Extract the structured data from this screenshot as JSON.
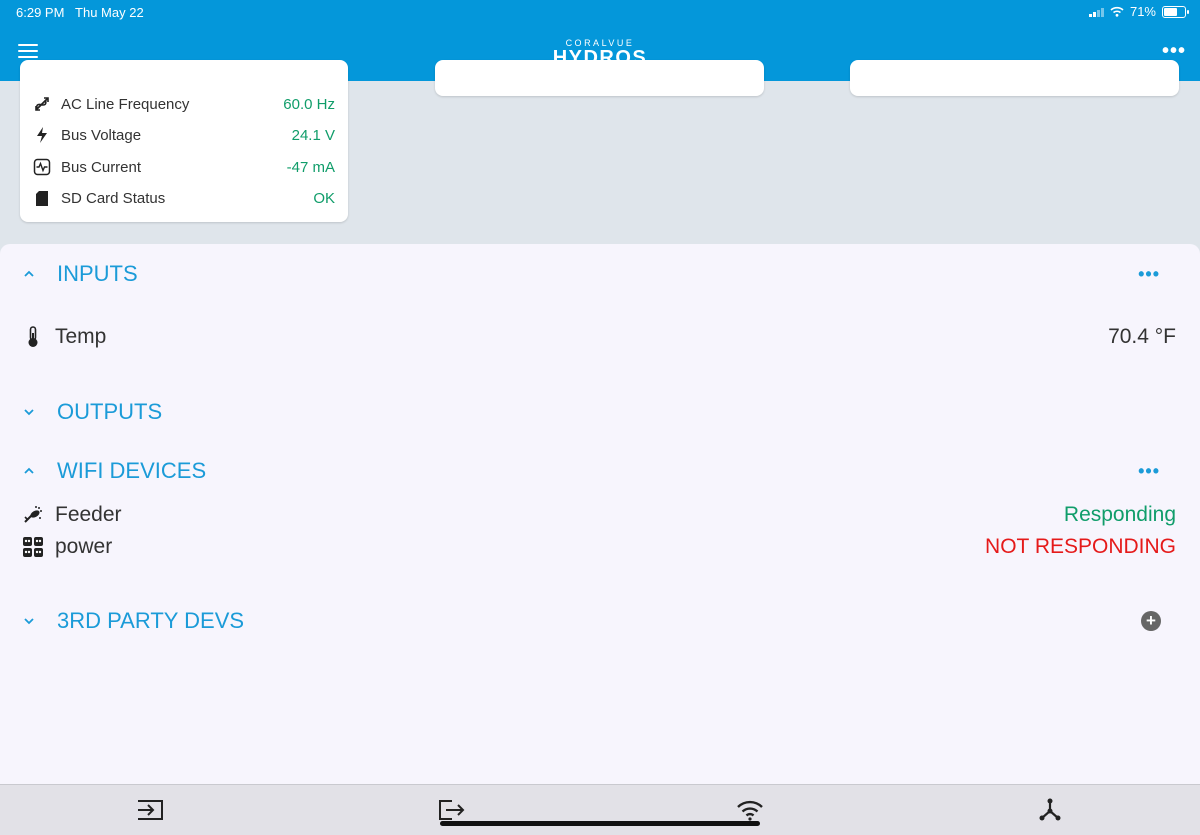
{
  "status_bar": {
    "time": "6:29 PM",
    "date": "Thu May 22",
    "battery": "71%"
  },
  "header": {
    "logo_top": "CORALVUE",
    "logo_main": "HYDROS",
    "more": "•••"
  },
  "system_card": {
    "rows": [
      {
        "icon": "frequency-icon",
        "label": "AC Line Frequency",
        "value": "60.0 Hz"
      },
      {
        "icon": "bolt-icon",
        "label": "Bus Voltage",
        "value": "24.1 V"
      },
      {
        "icon": "pulse-icon",
        "label": "Bus Current",
        "value": "-47 mA"
      },
      {
        "icon": "sd-card-icon",
        "label": "SD Card Status",
        "value": "OK"
      }
    ]
  },
  "sections": {
    "inputs": {
      "title": "INPUTS",
      "action": "•••",
      "items": [
        {
          "icon": "thermometer-icon",
          "label": "Temp",
          "value": "70.4 °F"
        }
      ]
    },
    "outputs": {
      "title": "OUTPUTS"
    },
    "wifi": {
      "title": "WIFI DEVICES",
      "action": "•••",
      "items": [
        {
          "icon": "feeder-icon",
          "label": "Feeder",
          "value": "Responding"
        },
        {
          "icon": "power-strip-icon",
          "label": "power",
          "value": "NOT RESPONDING"
        }
      ]
    },
    "third_party": {
      "title": "3RD PARTY DEVS",
      "action": "+"
    }
  },
  "colors": {
    "header": "#0497da",
    "accent": "#1b9bd8",
    "ok": "#109d6a",
    "error": "#e51a1a"
  }
}
